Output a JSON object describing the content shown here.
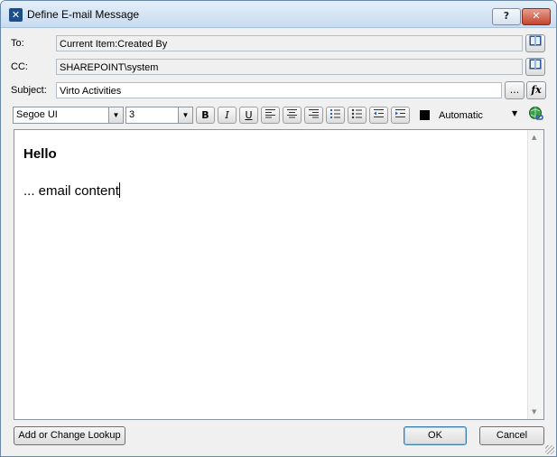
{
  "window": {
    "title": "Define E-mail Message",
    "help_glyph": "?",
    "close_glyph": "✕",
    "app_icon_glyph": "✕"
  },
  "fields": {
    "to": {
      "label": "To:",
      "value": "Current Item:Created By"
    },
    "cc": {
      "label": "CC:",
      "value": "SHAREPOINT\\system"
    },
    "subject": {
      "label": "Subject:",
      "value": "Virto Activities"
    }
  },
  "buttons": {
    "ellipsis": "...",
    "fx": "fx",
    "add_lookup": "Add or Change Lookup",
    "ok": "OK",
    "cancel": "Cancel"
  },
  "toolbar": {
    "font": "Segoe UI",
    "size": "3",
    "bold": "B",
    "italic": "I",
    "underline": "U",
    "color_label": "Automatic",
    "colors": {
      "text_color": "#000000"
    }
  },
  "editor": {
    "heading": "Hello",
    "body": "... email content"
  },
  "icons": {
    "address_book": "address-book-icon",
    "hyperlink": "hyperlink-icon"
  }
}
